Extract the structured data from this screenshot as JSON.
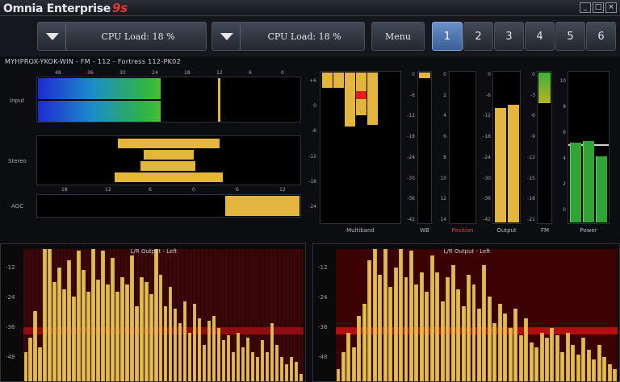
{
  "window": {
    "title": "Omnia Enterprise",
    "brand": "9s",
    "controls": [
      "_",
      "□",
      "×"
    ]
  },
  "toolbar": {
    "cpu_left": "CPU Load: 18 %",
    "cpu_right": "CPU Load: 18 %",
    "menu": "Menu",
    "presets": [
      "1",
      "2",
      "3",
      "4",
      "5",
      "6"
    ],
    "active_preset": "1"
  },
  "station": "MYHPROX-YKOK-WIN - FM - 112 - Fortress 112-PK02",
  "input_meter": {
    "label": "Input",
    "scale_top": [
      "48",
      "36",
      "30",
      "24",
      "18",
      "12",
      "6",
      "0"
    ],
    "left_level": 0.4,
    "right_level": 0.4,
    "peak_level": 0.68
  },
  "stereo_meter": {
    "label": "Stereo",
    "scale_bottom": [
      "18",
      "12",
      "6",
      "0",
      "6",
      "12"
    ]
  },
  "agc_meter": {
    "label": "AGC",
    "level": 0.28
  },
  "multiband": {
    "label": "Multiband",
    "scale": [
      "+6",
      "0",
      "-6",
      "-12",
      "-18",
      "-24"
    ],
    "bands": [
      0.1,
      0.1,
      0.35,
      0.28,
      0.34
    ]
  },
  "wb_meter": {
    "label": "WB",
    "scale": [
      "0",
      "-6",
      "-12",
      "-18",
      "-24",
      "-30",
      "-36",
      "-42"
    ],
    "level": 0.02
  },
  "position_meter": {
    "label": "Position",
    "scale": [
      "0",
      "2",
      "4",
      "6",
      "8",
      "10",
      "12",
      "14"
    ]
  },
  "output_meter": {
    "label": "Output",
    "scale": [
      "0",
      "-6",
      "-12",
      "-18",
      "-24",
      "-30",
      "-36",
      "-42"
    ],
    "levels": [
      0.75,
      0.77
    ]
  },
  "fm_meter": {
    "label": "FM",
    "scale": [
      "0",
      "-3",
      "-6",
      "-9",
      "-12",
      "-15",
      "-18",
      "-21"
    ],
    "level": 0.2
  },
  "power_meter": {
    "label": "Power",
    "scale": [
      "10",
      "8",
      "6",
      "4",
      "2",
      "0"
    ],
    "levels": [
      0.52,
      0.53,
      0.43
    ]
  },
  "spectrum_left": {
    "title": "L/R Output - Left",
    "axis": [
      "-12",
      "-24",
      "-36",
      "-48"
    ],
    "bars": [
      0.12,
      0.18,
      0.29,
      0.14,
      0.55,
      0.6,
      0.41,
      0.47,
      0.38,
      0.5,
      0.35,
      0.54,
      0.46,
      0.37,
      0.58,
      0.42,
      0.54,
      0.4,
      0.51,
      0.37,
      0.43,
      0.4,
      0.52,
      0.31,
      0.43,
      0.41,
      0.36,
      0.55,
      0.44,
      0.31,
      0.39,
      0.3,
      0.24,
      0.33,
      0.2,
      0.32,
      0.26,
      0.15,
      0.25,
      0.27,
      0.22,
      0.17,
      0.19,
      0.12,
      0.2,
      0.14,
      0.18,
      0.12,
      0.1,
      0.17,
      0.12,
      0.24,
      0.15,
      0.1,
      0.07,
      0.1,
      0.08,
      0.03
    ]
  },
  "spectrum_right": {
    "title": "L/R Output - Left",
    "axis": [
      "-12",
      "-24",
      "-36",
      "-48"
    ],
    "bars": [
      0.05,
      0.12,
      0.2,
      0.14,
      0.27,
      0.32,
      0.5,
      0.61,
      0.44,
      0.55,
      0.39,
      0.47,
      0.6,
      0.43,
      0.54,
      0.4,
      0.45,
      0.37,
      0.52,
      0.45,
      0.33,
      0.43,
      0.48,
      0.38,
      0.31,
      0.44,
      0.4,
      0.3,
      0.48,
      0.35,
      0.24,
      0.32,
      0.28,
      0.22,
      0.3,
      0.19,
      0.26,
      0.16,
      0.14,
      0.2,
      0.18,
      0.22,
      0.19,
      0.12,
      0.2,
      0.15,
      0.11,
      0.18,
      0.13,
      0.09,
      0.15,
      0.1,
      0.07,
      0.05
    ]
  },
  "colors": {
    "gold": "#e4b53c",
    "green": "#2fa536",
    "blue": "#2631c9",
    "clip": "#e02020"
  }
}
